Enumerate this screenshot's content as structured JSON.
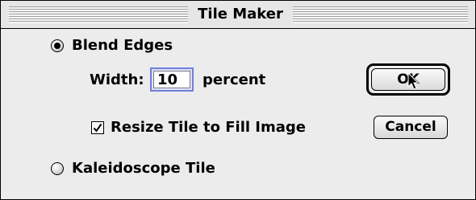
{
  "dialog": {
    "title": "Tile Maker"
  },
  "options": {
    "blend_edges": {
      "label": "Blend Edges",
      "selected": true
    },
    "width": {
      "label": "Width:",
      "value": "10",
      "unit": "percent"
    },
    "resize_tile": {
      "label": "Resize Tile to Fill Image",
      "checked": true
    },
    "kaleidoscope": {
      "label": "Kaleidoscope Tile",
      "selected": false
    }
  },
  "buttons": {
    "ok_label": "OK",
    "cancel_label": "Cancel"
  },
  "icons": {
    "cursor": "arrow-cursor-icon",
    "check": "checkmark-icon"
  }
}
